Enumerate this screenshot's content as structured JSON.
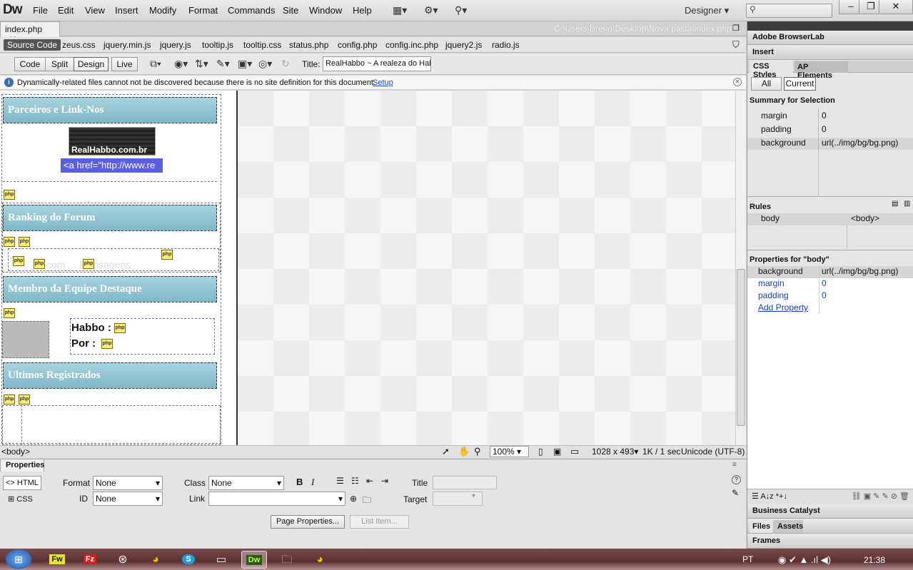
{
  "app": {
    "logo": "Dw",
    "menus": [
      "File",
      "Edit",
      "View",
      "Insert",
      "Modify",
      "Format",
      "Commands",
      "Site",
      "Window",
      "Help"
    ],
    "workspace": "Designer",
    "search_placeholder": ""
  },
  "document": {
    "tab": "index.php",
    "path": "C:\\Users\\Breno\\Desktop\\Nova pasta\\index.php",
    "source_code": "Source Code",
    "related_files": [
      "zeus.css",
      "jquery.min.js",
      "jquery.js",
      "tooltip.js",
      "tooltip.css",
      "status.php",
      "config.php",
      "config.inc.php",
      "jquery2.js",
      "radio.js"
    ],
    "views": [
      "Code",
      "Split",
      "Design",
      "Live"
    ],
    "active_view": "Design",
    "title_label": "Title:",
    "title_value": "RealHabbo ~ A realeza do Hab"
  },
  "infobar": {
    "message": "Dynamically-related files cannot not be discovered because there is no site definition for this document.",
    "link": "Setup"
  },
  "design": {
    "sections": [
      "Parceiros e Link-Nos",
      "Ranking do Forum",
      "Membro da Equipe Destaque",
      "Ultimos Registrados"
    ],
    "banner_text": "RealHabbo.com.br",
    "link_code": "<a href=\"http://www.re",
    "ranking_faded": "com ... Mensagens",
    "habbo_label": "Habbo :",
    "por_label": "Por :",
    "php_tag": "php"
  },
  "status": {
    "tag": "<body>",
    "zoom": "100%",
    "size": "1028 x 493",
    "download": "1K / 1 sec",
    "encoding": "Unicode (UTF-8)"
  },
  "properties": {
    "title": "Properties",
    "html_label": "HTML",
    "css_label": "CSS",
    "format_label": "Format",
    "format_value": "None",
    "class_label": "Class",
    "class_value": "None",
    "id_label": "ID",
    "id_value": "None",
    "link_label": "Link",
    "title_label": "Title",
    "target_label": "Target",
    "page_props": "Page Properties...",
    "list_item": "List Item...",
    "bold": "B",
    "italic": "I"
  },
  "panels": {
    "browserlab": "Adobe BrowserLab",
    "insert": "Insert",
    "css_tab": "CSS Styles",
    "ap_tab": "AP Elements",
    "all": "All",
    "current": "Current",
    "summary_title": "Summary for Selection",
    "summary": [
      {
        "k": "margin",
        "v": "0"
      },
      {
        "k": "padding",
        "v": "0"
      },
      {
        "k": "background",
        "v": "url(../img/bg/bg.png)"
      }
    ],
    "rules_title": "Rules",
    "rule_selector": "body",
    "rule_tag": "<body>",
    "props_title": "Properties for \"body\"",
    "props": [
      {
        "k": "background",
        "v": "url(../img/bg/bg.png)"
      },
      {
        "k": "margin",
        "v": "0"
      },
      {
        "k": "padding",
        "v": "0"
      }
    ],
    "add_property": "Add Property",
    "business": "Business Catalyst",
    "files": "Files",
    "assets": "Assets",
    "frames": "Frames"
  },
  "taskbar": {
    "lang": "PT",
    "time": "21:38",
    "apps": [
      "Fw",
      "Fz",
      "Ch",
      "Sk",
      "Ex",
      "Dw",
      "Fo",
      "Ch"
    ]
  }
}
